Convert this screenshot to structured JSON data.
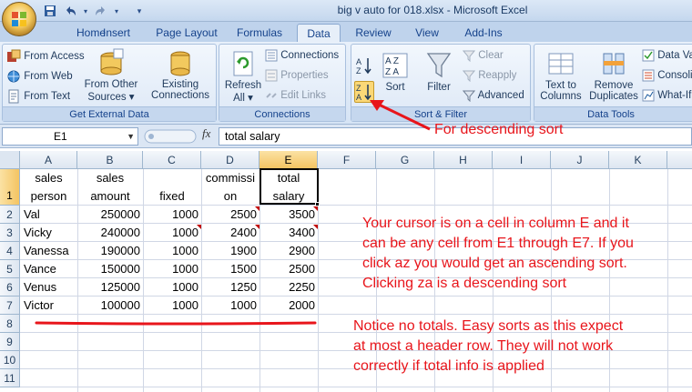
{
  "window": {
    "title": "big v auto for 018.xlsx - Microsoft Excel"
  },
  "tabs": [
    {
      "label": "Home"
    },
    {
      "label": "Insert"
    },
    {
      "label": "Page Layout"
    },
    {
      "label": "Formulas"
    },
    {
      "label": "Data"
    },
    {
      "label": "Review"
    },
    {
      "label": "View"
    },
    {
      "label": "Add-Ins"
    }
  ],
  "ribbon": {
    "get_external": {
      "from_access": "From Access",
      "from_web": "From Web",
      "from_text": "From Text",
      "from_other_1": "From Other",
      "from_other_2": "Sources",
      "existing_1": "Existing",
      "existing_2": "Connections",
      "label": "Get External Data"
    },
    "connections": {
      "refresh_1": "Refresh",
      "refresh_2": "All",
      "connections": "Connections",
      "properties": "Properties",
      "edit_links": "Edit Links",
      "label": "Connections"
    },
    "sort_filter": {
      "sort": "Sort",
      "filter": "Filter",
      "clear": "Clear",
      "reapply": "Reapply",
      "advanced": "Advanced",
      "label": "Sort & Filter"
    },
    "data_tools": {
      "text_to_1": "Text to",
      "text_to_2": "Columns",
      "remove_1": "Remove",
      "remove_2": "Duplicates",
      "data_val": "Data Va",
      "consol": "Consoli",
      "whatif": "What-If",
      "label": "Data Tools"
    }
  },
  "formula_bar": {
    "name_box": "E1",
    "fx": "fx",
    "content": "total salary"
  },
  "sheet": {
    "columns": [
      "A",
      "B",
      "C",
      "D",
      "E",
      "F",
      "G",
      "H",
      "I",
      "J",
      "K"
    ],
    "rows": [
      "1",
      "2",
      "3",
      "4",
      "5",
      "6",
      "7",
      "8",
      "9",
      "10",
      "11"
    ],
    "header": {
      "a_top": "sales",
      "a_bot": "person",
      "b_top": "sales",
      "b_bot": "amount",
      "c_bot": "fixed",
      "d_top": "commissi",
      "d_bot": "on",
      "e_top": "total",
      "e_bot": "salary"
    },
    "data": [
      [
        "Val",
        "250000",
        "1000",
        "2500",
        "3500"
      ],
      [
        "Vicky",
        "240000",
        "1000",
        "2400",
        "3400"
      ],
      [
        "Vanessa",
        "190000",
        "1000",
        "1900",
        "2900"
      ],
      [
        "Vance",
        "150000",
        "1000",
        "1500",
        "2500"
      ],
      [
        "Venus",
        "125000",
        "1000",
        "1250",
        "2250"
      ],
      [
        "Victor",
        "100000",
        "1000",
        "1000",
        "2000"
      ]
    ]
  },
  "annotations": {
    "descending": "For descending sort",
    "cursor_note": [
      "Your cursor is on a cell in column E and it",
      "can be any cell from E1 through E7. If you",
      "click az you would get an ascending sort.",
      "Clicking za is a descending sort"
    ],
    "totals_note": [
      "Notice no totals. Easy sorts as this expect",
      "at most a header row. They will not work",
      "correctly if total info is applied"
    ]
  },
  "colors": {
    "annotation": "#e8151b",
    "selected_header": "#f4c462"
  }
}
